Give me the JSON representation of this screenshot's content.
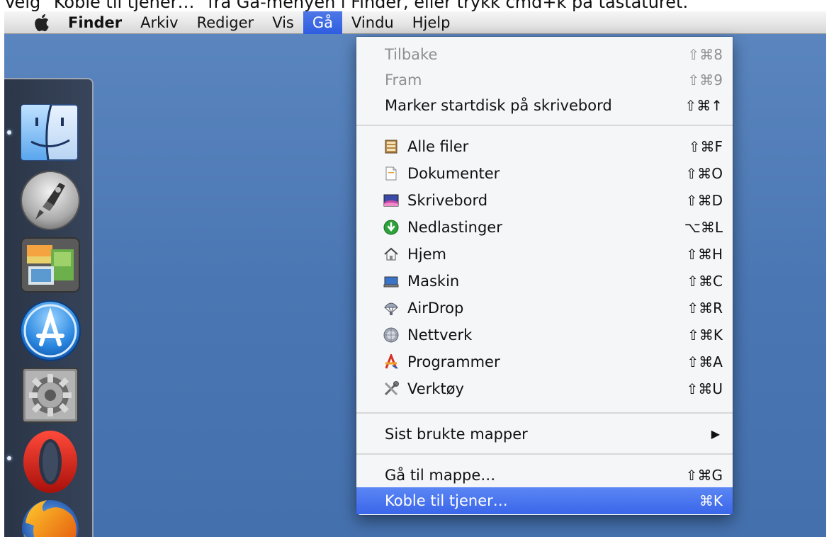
{
  "caption": "Velg \"Koble til tjener…\" fra Gå-menyen i Finder, eller trykk cmd+k på tastaturet.",
  "menubar": {
    "apple_icon": "apple-icon",
    "items": [
      {
        "label": "Finder"
      },
      {
        "label": "Arkiv"
      },
      {
        "label": "Rediger"
      },
      {
        "label": "Vis"
      },
      {
        "label": "Gå"
      },
      {
        "label": "Vindu"
      },
      {
        "label": "Hjelp"
      }
    ]
  },
  "menu": {
    "items": [
      {
        "label": "Tilbake",
        "shortcut": "⇧⌘8",
        "disabled": true
      },
      {
        "label": "Fram",
        "shortcut": "⇧⌘9",
        "disabled": true
      },
      {
        "label": "Marker startdisk på skrivebord",
        "shortcut": "⇧⌘↑"
      },
      {
        "label": "Alle filer",
        "shortcut": "⇧⌘F",
        "icon": "all-files-icon"
      },
      {
        "label": "Dokumenter",
        "shortcut": "⇧⌘O",
        "icon": "documents-icon"
      },
      {
        "label": "Skrivebord",
        "shortcut": "⇧⌘D",
        "icon": "desktop-icon"
      },
      {
        "label": "Nedlastinger",
        "shortcut": "⌥⌘L",
        "icon": "downloads-icon"
      },
      {
        "label": "Hjem",
        "shortcut": "⇧⌘H",
        "icon": "home-icon"
      },
      {
        "label": "Maskin",
        "shortcut": "⇧⌘C",
        "icon": "computer-icon"
      },
      {
        "label": "AirDrop",
        "shortcut": "⇧⌘R",
        "icon": "airdrop-icon"
      },
      {
        "label": "Nettverk",
        "shortcut": "⇧⌘K",
        "icon": "network-icon"
      },
      {
        "label": "Programmer",
        "shortcut": "⇧⌘A",
        "icon": "applications-icon"
      },
      {
        "label": "Verktøy",
        "shortcut": "⇧⌘U",
        "icon": "utilities-icon"
      },
      {
        "label": "Sist brukte mapper",
        "submenu": "▶"
      },
      {
        "label": "Gå til mappe…",
        "shortcut": "⇧⌘G"
      },
      {
        "label": "Koble til tjener…",
        "shortcut": "⌘K",
        "highlighted": true
      }
    ]
  },
  "dock": {
    "items": [
      {
        "icon": "finder-icon"
      },
      {
        "icon": "launchpad-icon"
      },
      {
        "icon": "photo-browser-icon"
      },
      {
        "icon": "app-store-icon"
      },
      {
        "icon": "system-preferences-icon"
      },
      {
        "icon": "opera-icon"
      },
      {
        "icon": "firefox-icon"
      }
    ]
  },
  "colors": {
    "desktop": "#4a76b3",
    "highlight": "#3a66ea"
  }
}
